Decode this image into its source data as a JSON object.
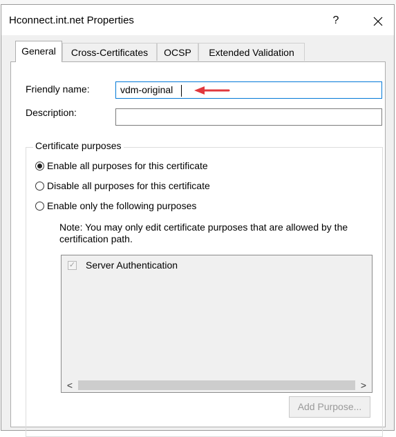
{
  "window": {
    "title": "Hconnect.int.net Properties",
    "help_label": "?",
    "close_icon": "close-icon"
  },
  "tabs": [
    {
      "label": "General",
      "active": true
    },
    {
      "label": "Cross-Certificates",
      "active": false
    },
    {
      "label": "OCSP",
      "active": false
    },
    {
      "label": "Extended Validation",
      "active": false
    }
  ],
  "general": {
    "friendly_name_label": "Friendly name:",
    "friendly_name_value": "vdm-original",
    "description_label": "Description:",
    "description_value": "",
    "purposes_group_label": "Certificate purposes",
    "radios": [
      {
        "label": "Enable all purposes for this certificate",
        "selected": true
      },
      {
        "label": "Disable all purposes for this certificate",
        "selected": false
      },
      {
        "label": "Enable only the following purposes",
        "selected": false
      }
    ],
    "note": "Note: You may only edit certificate purposes that are allowed by the certification path.",
    "purposes": [
      {
        "label": "Server Authentication",
        "checked": true,
        "enabled": false
      }
    ],
    "add_purpose_label": "Add Purpose..."
  },
  "annotation": {
    "arrow_color": "#e0383e"
  },
  "colors": {
    "focus_border": "#0078d7",
    "disabled_text": "#9a9a9a"
  }
}
